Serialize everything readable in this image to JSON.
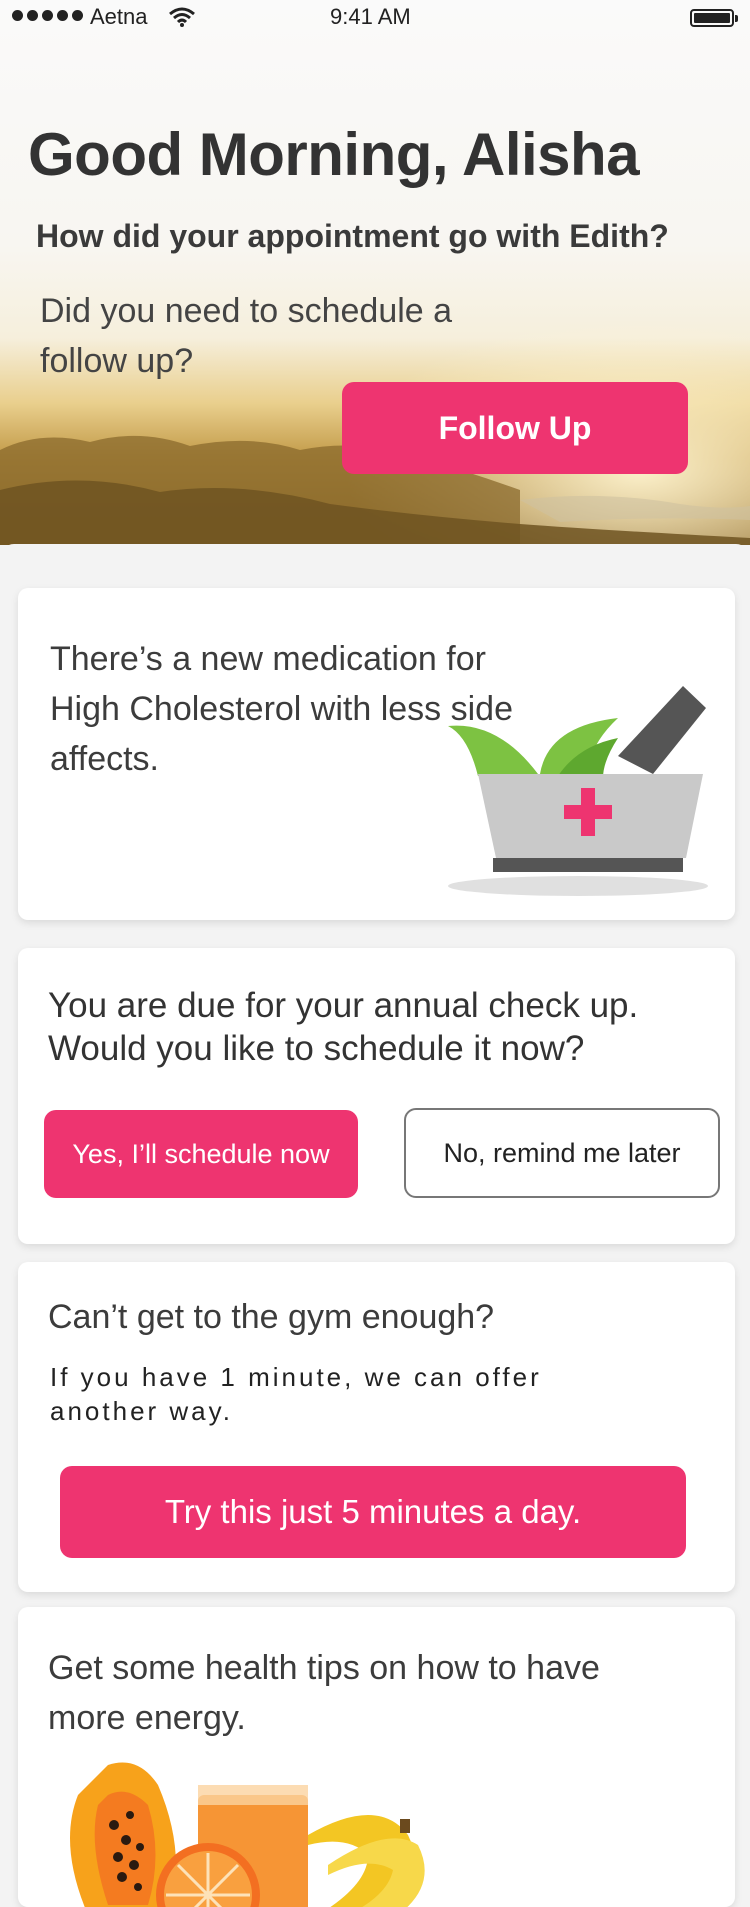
{
  "status_bar": {
    "carrier": "Aetna",
    "time": "9:41 AM"
  },
  "hero": {
    "greeting": "Good Morning, Alisha",
    "appointment_question": "How did your appointment go with Edith?",
    "followup_prompt": "Did you need to schedule a follow up?",
    "followup_button": "Follow Up"
  },
  "cards": {
    "medication": {
      "text": "There’s a new medication for High Cholesterol with less side affects."
    },
    "checkup": {
      "text": "You are due for your annual check up. Would you like to schedule it now?",
      "yes_button": "Yes, I’ll schedule now",
      "no_button": "No, remind me later"
    },
    "gym": {
      "title": "Can’t get to the gym enough?",
      "subtitle": "If you have 1 minute, we can offer another way.",
      "button": "Try this just 5 minutes a day."
    },
    "tips": {
      "text": "Get some health tips on how to have more energy."
    }
  },
  "colors": {
    "accent": "#ee3470",
    "leaf": "#7dc242",
    "bowl": "#c9c9c9",
    "pestle": "#555555"
  }
}
